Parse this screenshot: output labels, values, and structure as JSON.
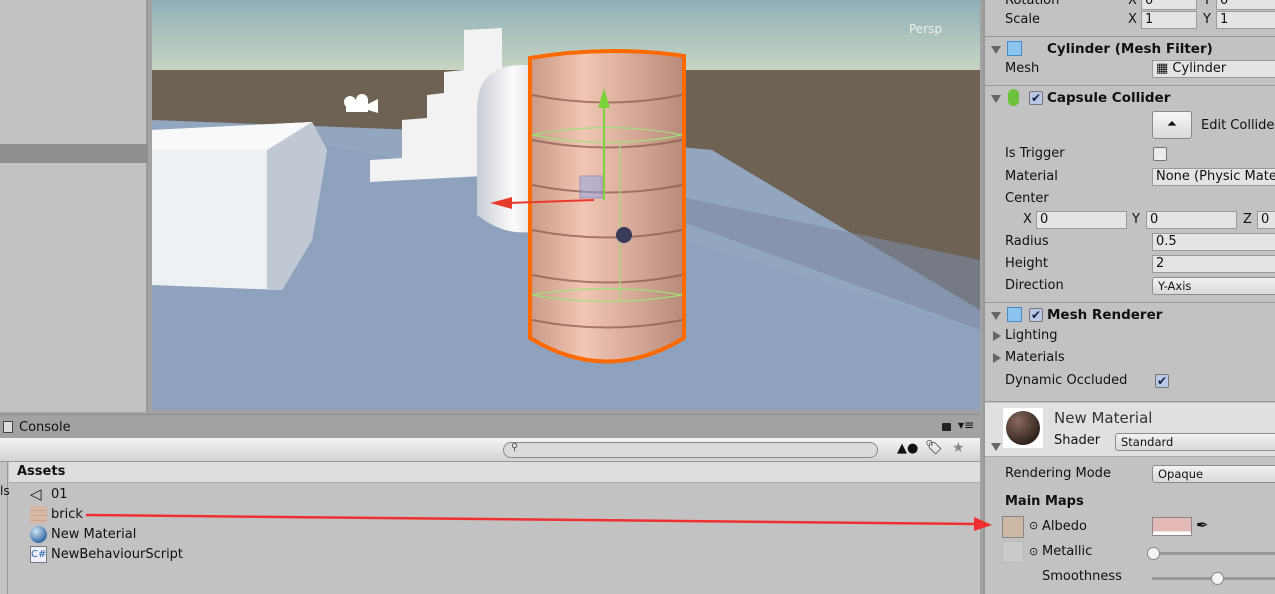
{
  "scene": {
    "view_label": "Persp",
    "selection_outline_color": "#ff6a00"
  },
  "console": {
    "tab_label": "Console"
  },
  "project": {
    "search_placeholder": "",
    "header": "Assets",
    "items": [
      {
        "name": "01",
        "icon": "unity-scene-icon"
      },
      {
        "name": "brick",
        "icon": "texture-icon"
      },
      {
        "name": "New Material",
        "icon": "material-sphere-icon"
      },
      {
        "name": "NewBehaviourScript",
        "icon": "csharp-script-icon"
      }
    ],
    "side_label": "ls"
  },
  "inspector": {
    "transform": {
      "rotation_label": "Rotation",
      "rotation": {
        "x": "0",
        "y": "0"
      },
      "scale_label": "Scale",
      "scale": {
        "x": "1",
        "y": "1"
      }
    },
    "mesh_filter": {
      "title": "Cylinder (Mesh Filter)",
      "mesh_label": "Mesh",
      "mesh_value": "Cylinder"
    },
    "capsule_collider": {
      "title": "Capsule Collider",
      "enabled": true,
      "edit_collider_label": "Edit Collider",
      "is_trigger_label": "Is Trigger",
      "is_trigger": false,
      "material_label": "Material",
      "material_value": "None (Physic Material)",
      "center_label": "Center",
      "center": {
        "x": "0",
        "y": "0",
        "z": "0"
      },
      "radius_label": "Radius",
      "radius": "0.5",
      "height_label": "Height",
      "height": "2",
      "direction_label": "Direction",
      "direction": "Y-Axis"
    },
    "mesh_renderer": {
      "title": "Mesh Renderer",
      "enabled": true,
      "lighting_label": "Lighting",
      "materials_label": "Materials",
      "dynamic_occluded_label": "Dynamic Occluded",
      "dynamic_occluded": true
    },
    "material": {
      "name": "New Material",
      "shader_label": "Shader",
      "shader": "Standard",
      "rendering_mode_label": "Rendering Mode",
      "rendering_mode": "Opaque",
      "main_maps_label": "Main Maps",
      "albedo_label": "Albedo",
      "albedo_color": "#e6b9b9",
      "metallic_label": "Metallic",
      "metallic": 0,
      "smoothness_label": "Smoothness",
      "smoothness": 0.5
    }
  },
  "annotation": {
    "arrow_color": "#f03030"
  }
}
